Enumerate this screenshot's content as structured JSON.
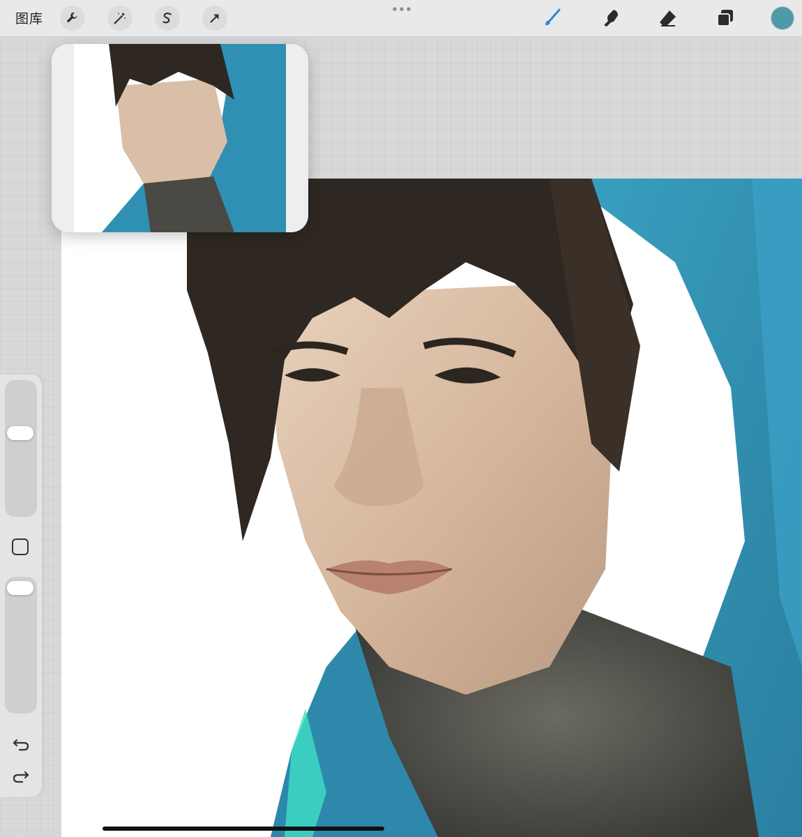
{
  "toolbar": {
    "gallery_label": "图库",
    "tools_left": [
      {
        "icon": "wrench-icon",
        "name": "actions"
      },
      {
        "icon": "magic-wand-icon",
        "name": "adjustments"
      },
      {
        "icon": "selection-s-icon",
        "name": "selection"
      },
      {
        "icon": "arrow-cursor-icon",
        "name": "transform"
      }
    ],
    "more_icon": "ellipsis-icon",
    "tools_right": [
      {
        "icon": "brush-icon",
        "name": "paint",
        "active": true
      },
      {
        "icon": "smudge-icon",
        "name": "smudge"
      },
      {
        "icon": "eraser-icon",
        "name": "eraser"
      },
      {
        "icon": "layers-icon",
        "name": "layers"
      }
    ],
    "active_color": "#4f9aa8"
  },
  "sidebar": {
    "brush_size_level": 0.4,
    "opacity_level": 0.08,
    "icons": [
      "modify-square-icon",
      "undo-icon",
      "redo-icon"
    ]
  },
  "colors": {
    "hood_blue": "#2f8fb0",
    "hood_highlight": "#4cc9c6",
    "hair": "#2d2620",
    "skin": "#d9bfa8"
  }
}
